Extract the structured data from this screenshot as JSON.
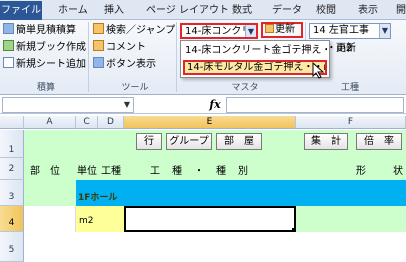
{
  "ribbon_tabs": [
    "ファイル",
    "ホーム",
    "挿入",
    "ページ レイアウト",
    "数式",
    "データ",
    "校閲",
    "表示",
    "開"
  ],
  "groups": {
    "sekisan": {
      "label": "積算",
      "items": [
        "簡単見積積算",
        "新規ブック作成",
        "新規シート追加"
      ]
    },
    "tools": {
      "label": "ツール",
      "items": [
        "検索／ジャンプ",
        "コメント",
        "ボタン表示"
      ]
    },
    "master": {
      "label": "マスタ",
      "combo_value": "14-床コンクリー",
      "update_label": "更新",
      "second_update_label": "更新",
      "dropdown_items": [
        "14-床コンクリート金ゴテ押え・・m2",
        "14-床モルタル金ゴテ押え・・m2"
      ]
    },
    "kouji": {
      "label": "工種",
      "combo_value": "14 左官工事"
    }
  },
  "formula_bar": {
    "fx": "fx",
    "name": "",
    "formula": ""
  },
  "columns": [
    "A",
    "C",
    "D",
    "E",
    "F"
  ],
  "rows": [
    "1",
    "2",
    "3",
    "4",
    "5"
  ],
  "sheet": {
    "buttons": [
      "行",
      "グループ",
      "部　屋",
      "集　計",
      "倍　率"
    ],
    "headers": [
      "部　位",
      "単位",
      "工種",
      "工　種　・　種　別",
      "形",
      "状"
    ],
    "row3_label": "1Fホール",
    "row4_unit": "m2"
  },
  "colors": {
    "cyan_band": "#00b0f0",
    "light_green": "#ccffcc",
    "light_yellow": "#ffff99",
    "highlight_red": "#e0262b",
    "ribbon_blue": "#2b5797"
  }
}
